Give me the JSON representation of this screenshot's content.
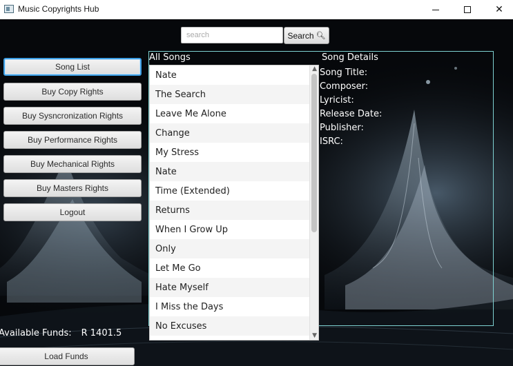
{
  "window": {
    "title": "Music Copyrights Hub",
    "minimize_icon": "minimize-icon",
    "maximize_icon": "maximize-icon",
    "close_icon": "close-icon"
  },
  "search": {
    "placeholder": "search",
    "value": "",
    "button_label": "Search",
    "button_icon": "magnifier-icon"
  },
  "sidebar": {
    "items": [
      {
        "label": "Song List",
        "active": true
      },
      {
        "label": "Buy Copy Rights",
        "active": false
      },
      {
        "label": "Buy Sysncronization Rights",
        "active": false
      },
      {
        "label": "Buy Performance Rights",
        "active": false
      },
      {
        "label": "Buy Mechanical Rights",
        "active": false
      },
      {
        "label": "Buy Masters Rights",
        "active": false
      },
      {
        "label": "Logout",
        "active": false
      }
    ]
  },
  "songs": {
    "heading": "All Songs",
    "items": [
      "Nate",
      "The Search",
      "Leave Me Alone",
      "Change",
      "My Stress",
      "Nate",
      "Time (Extended)",
      "Returns",
      "When I Grow Up",
      "Only",
      "Let Me Go",
      "Hate Myself",
      "I Miss the Days",
      "No Excuses"
    ]
  },
  "details": {
    "heading": "Song Details",
    "fields": [
      "Song Title:",
      "Composer:",
      "Lyricist:",
      "Release Date:",
      "Publisher:",
      "ISRC:"
    ]
  },
  "funds": {
    "label": "Available Funds:",
    "amount": "R 1401.5",
    "load_label": "Load Funds"
  },
  "colors": {
    "accent_focus": "#3c9ee4",
    "panel_border": "#7fd3d3",
    "background": "#06080b"
  }
}
